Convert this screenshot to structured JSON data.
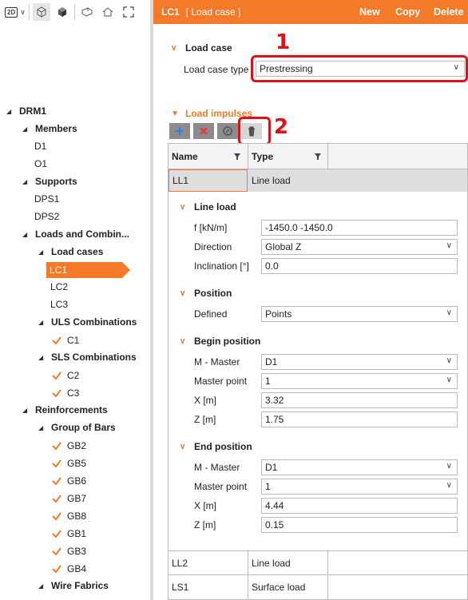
{
  "toolbar": {
    "mode_badge": "2D"
  },
  "tree": {
    "root": "DRM1",
    "members_label": "Members",
    "members": [
      "D1",
      "O1"
    ],
    "supports_label": "Supports",
    "supports": [
      "DPS1",
      "DPS2"
    ],
    "loads_label": "Loads and Combin...",
    "load_cases_label": "Load cases",
    "load_cases": [
      "LC1",
      "LC2",
      "LC3"
    ],
    "uls_label": "ULS Combinations",
    "uls": [
      "C1"
    ],
    "sls_label": "SLS Combinations",
    "sls": [
      "C2",
      "C3"
    ],
    "reinforcements_label": "Reinforcements",
    "group_of_bars_label": "Group of Bars",
    "bars": [
      "GB2",
      "GB5",
      "GB6",
      "GB7",
      "GB8",
      "GB1",
      "GB3",
      "GB4"
    ],
    "wire_fabrics_label": "Wire Fabrics"
  },
  "header": {
    "title": "LC1",
    "subtitle": "[ Load case ]",
    "new_label": "New",
    "copy_label": "Copy",
    "delete_label": "Delete"
  },
  "load_case": {
    "section_label": "Load case",
    "type_label": "Load case type",
    "type_value": "Prestressing"
  },
  "load_impulses": {
    "section_label": "Load impulses"
  },
  "annotations": {
    "one": "1",
    "two": "2"
  },
  "table": {
    "col_name": "Name",
    "col_type": "Type",
    "rows": [
      {
        "name": "LL1",
        "type": "Line load"
      },
      {
        "name": "LL2",
        "type": "Line load"
      },
      {
        "name": "LS1",
        "type": "Surface load"
      }
    ]
  },
  "detail": {
    "line_load_label": "Line load",
    "f_label": "f [kN/m]",
    "f_value": "-1450.0 -1450.0",
    "direction_label": "Direction",
    "direction_value": "Global Z",
    "inclination_label": "Inclination [°]",
    "inclination_value": "0.0",
    "position_label": "Position",
    "defined_label": "Defined",
    "defined_value": "Points",
    "begin_label": "Begin position",
    "begin_master_label": "M - Master",
    "begin_master_value": "D1",
    "begin_point_label": "Master point",
    "begin_point_value": "1",
    "begin_x_label": "X [m]",
    "begin_x_value": "3.32",
    "begin_z_label": "Z [m]",
    "begin_z_value": "1.75",
    "end_label": "End position",
    "end_master_label": "M - Master",
    "end_master_value": "D1",
    "end_point_label": "Master point",
    "end_point_value": "1",
    "end_x_label": "X [m]",
    "end_x_value": "4.44",
    "end_z_label": "Z [m]",
    "end_z_value": "0.15"
  },
  "colors": {
    "accent": "#f47a2a",
    "annotation": "#e0101a"
  }
}
